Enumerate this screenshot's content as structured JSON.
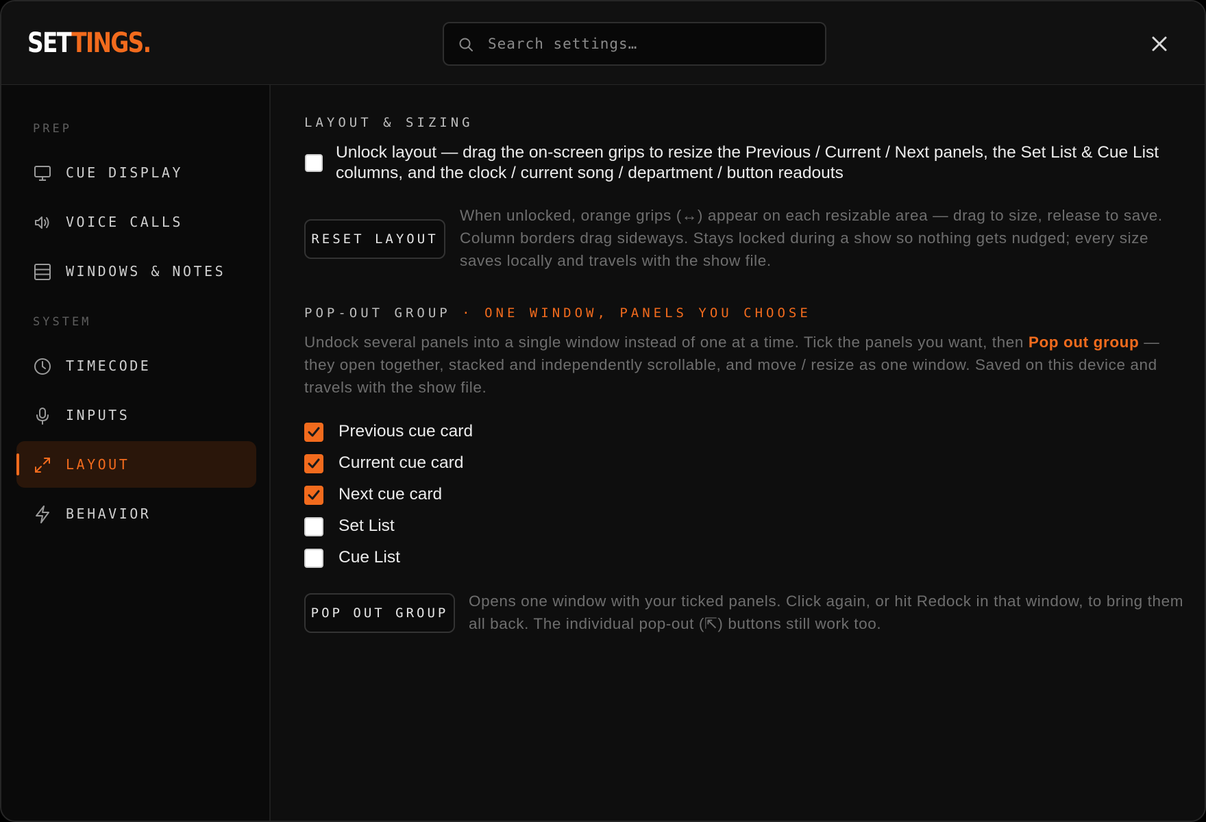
{
  "header": {
    "logo_part1": "SET",
    "logo_part2": "TINGS.",
    "search_placeholder": "Search settings…",
    "close_label": "Close"
  },
  "sidebar": {
    "sections": [
      {
        "label": "PREP",
        "items": [
          {
            "label": "CUE DISPLAY",
            "icon": "monitor-icon"
          },
          {
            "label": "VOICE CALLS",
            "icon": "speaker-icon"
          },
          {
            "label": "WINDOWS & NOTES",
            "icon": "panel-icon"
          }
        ]
      },
      {
        "label": "SYSTEM",
        "items": [
          {
            "label": "TIMECODE",
            "icon": "clock-icon"
          },
          {
            "label": "INPUTS",
            "icon": "microphone-icon"
          },
          {
            "label": "LAYOUT",
            "icon": "expand-icon",
            "active": true
          },
          {
            "label": "BEHAVIOR",
            "icon": "lightning-icon"
          }
        ]
      }
    ]
  },
  "main": {
    "layout_section": {
      "heading": "LAYOUT & SIZING",
      "unlock_checked": false,
      "unlock_text": "Unlock layout — drag the on-screen grips to resize the Previous / Current / Next panels, the Set List & Cue List columns, and the clock / current song / department / button readouts",
      "reset_button": "RESET LAYOUT",
      "reset_help": "When unlocked, orange grips (↔) appear on each resizable area — drag to size, release to save. Column borders drag sideways. Stays locked during a show so nothing gets nudged; every size saves locally and travels with the show file."
    },
    "popout_section": {
      "heading": "POP-OUT GROUP",
      "heading_separator": "·",
      "heading_accent": "ONE WINDOW, PANELS YOU CHOOSE",
      "description_part1": "Undock several panels into a single window instead of one at a time. Tick the panels you want, then ",
      "description_link": "Pop out group",
      "description_part2": " — they open together, stacked and independently scrollable, and move / resize as one window. Saved on this device and travels with the show file.",
      "panels": [
        {
          "label": "Previous cue card",
          "checked": true
        },
        {
          "label": "Current cue card",
          "checked": true
        },
        {
          "label": "Next cue card",
          "checked": true
        },
        {
          "label": "Set List",
          "checked": false
        },
        {
          "label": "Cue List",
          "checked": false
        }
      ],
      "popout_button": "POP OUT GROUP",
      "popout_help": "Opens one window with your ticked panels. Click again, or hit Redock in that window, to bring them all back. The individual pop-out (⇱) buttons still work too."
    }
  },
  "colors": {
    "accent": "#f26b1d",
    "background": "#0e0e0e",
    "sidebar": "#0a0a0a",
    "active_item_bg": "#2a160a"
  }
}
